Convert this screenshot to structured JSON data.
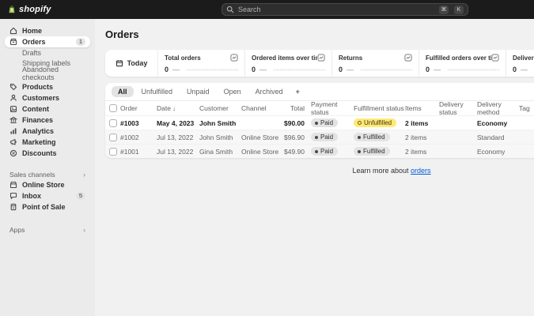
{
  "topbar": {
    "logo": "shopify",
    "search": {
      "placeholder": "Search",
      "key_cmd": "⌘",
      "key_k": "K"
    }
  },
  "sidebar": {
    "items": [
      {
        "label": "Home"
      },
      {
        "label": "Orders",
        "badge": "1"
      },
      {
        "label": "Drafts"
      },
      {
        "label": "Shipping labels"
      },
      {
        "label": "Abandoned checkouts"
      },
      {
        "label": "Products"
      },
      {
        "label": "Customers"
      },
      {
        "label": "Content"
      },
      {
        "label": "Finances"
      },
      {
        "label": "Analytics"
      },
      {
        "label": "Marketing"
      },
      {
        "label": "Discounts"
      }
    ],
    "sales_channels_header": "Sales channels",
    "channels": [
      {
        "label": "Online Store"
      },
      {
        "label": "Inbox",
        "badge": "5"
      },
      {
        "label": "Point of Sale"
      }
    ],
    "apps_header": "Apps",
    "chevron": "›"
  },
  "main": {
    "title": "Orders",
    "date_filter_label": "Today",
    "metrics": [
      {
        "label": "Total orders",
        "value": "0",
        "dash": "—"
      },
      {
        "label": "Ordered items over time",
        "value": "0",
        "dash": "—"
      },
      {
        "label": "Returns",
        "value": "0",
        "dash": "—"
      },
      {
        "label": "Fulfilled orders over time",
        "value": "0",
        "dash": "—"
      },
      {
        "label": "Delivered orders over time",
        "value": "0",
        "dash": "—"
      }
    ],
    "tabs": [
      {
        "label": "All"
      },
      {
        "label": "Unfulfilled"
      },
      {
        "label": "Unpaid"
      },
      {
        "label": "Open"
      },
      {
        "label": "Archived"
      }
    ],
    "add_tab_label": "+",
    "table": {
      "columns": {
        "order": "Order",
        "date": "Date",
        "customer": "Customer",
        "channel": "Channel",
        "total": "Total",
        "payment": "Payment status",
        "fulfillment": "Fulfillment status",
        "items": "Items",
        "delivery_status": "Delivery status",
        "delivery_method": "Delivery method",
        "tag": "Tag"
      },
      "sort_icon": "↓",
      "rows": [
        {
          "order": "#1003",
          "date": "May 4, 2023",
          "customer": "John Smith",
          "channel": "",
          "total": "$90.00",
          "payment_status": "Paid",
          "fulfillment_status": "Unfulfilled",
          "items": "2 items",
          "delivery_status": "",
          "delivery_method": "Economy"
        },
        {
          "order": "#1002",
          "date": "Jul 13, 2022",
          "customer": "John Smith",
          "channel": "Online Store",
          "total": "$96.90",
          "payment_status": "Paid",
          "fulfillment_status": "Fulfilled",
          "items": "2 items",
          "delivery_status": "",
          "delivery_method": "Standard"
        },
        {
          "order": "#1001",
          "date": "Jul 13, 2022",
          "customer": "Gina Smith",
          "channel": "Online Store",
          "total": "$49.90",
          "payment_status": "Paid",
          "fulfillment_status": "Fulfilled",
          "items": "2 items",
          "delivery_status": "",
          "delivery_method": "Economy"
        }
      ]
    },
    "footer": {
      "text": "Learn more about",
      "link_label": "orders"
    }
  },
  "colors": {
    "topbar_bg": "#1b1b1b",
    "sidebar_bg": "#ebebeb",
    "page_bg": "#f1f1f1",
    "accent_link": "#005bd3",
    "attention_badge": "#ffe978",
    "neutral_badge": "#e3e3e3",
    "logo_green": "#95bf47"
  }
}
